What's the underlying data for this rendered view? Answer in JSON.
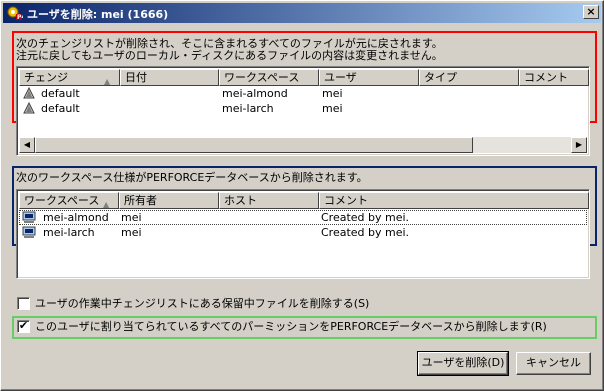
{
  "window": {
    "title": "ユーザを削除: mei (1666)",
    "close_label": "×"
  },
  "changelists": {
    "message_line1": "次のチェンジリストが削除され、そこに含まれるすべてのファイルが元に戻されます。",
    "message_line2": "注元に戻してもユーザのローカル・ディスクにあるファイルの内容は変更されません。",
    "columns": [
      "チェンジ",
      "日付",
      "ワークスペース",
      "ユーザ",
      "タイプ",
      "コメント"
    ],
    "rows": [
      {
        "icon": "changelist-icon",
        "change": "default",
        "date": "",
        "workspace": "mei-almond",
        "user": "mei",
        "type": "",
        "comment": ""
      },
      {
        "icon": "changelist-icon",
        "change": "default",
        "date": "",
        "workspace": "mei-larch",
        "user": "mei",
        "type": "",
        "comment": ""
      }
    ]
  },
  "workspaces": {
    "message": "次のワークスペース仕様がPERFORCEデータベースから削除されます。",
    "columns": [
      "ワークスペース",
      "所有者",
      "ホスト",
      "コメント"
    ],
    "rows": [
      {
        "icon": "workspace-icon",
        "name": "mei-almond",
        "owner": "mei",
        "host": "",
        "comment": "Created by mei."
      },
      {
        "icon": "workspace-icon",
        "name": "mei-larch",
        "owner": "mei",
        "host": "",
        "comment": "Created by mei."
      }
    ]
  },
  "options": {
    "delete_shelved_label": "ユーザの作業中チェンジリストにある保留中ファイルを削除する(S)",
    "delete_shelved_checked": false,
    "delete_permissions_label": "このユーザに割り当てられているすべてのパーミッションをPERFORCEデータベースから削除します(R)",
    "delete_permissions_checked": true,
    "check_mark": "✔"
  },
  "buttons": {
    "delete_user": "ユーザを削除(D)",
    "cancel": "キャンセル"
  }
}
